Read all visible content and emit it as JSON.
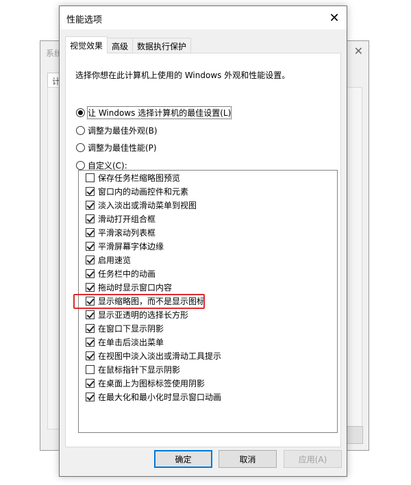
{
  "background_window": {
    "title": "系统",
    "tab_label": "计"
  },
  "dialog": {
    "title": "性能选项",
    "close_glyph": "✕",
    "tabs": [
      {
        "label": "视觉效果",
        "active": true
      },
      {
        "label": "高级",
        "active": false
      },
      {
        "label": "数据执行保护",
        "active": false
      }
    ],
    "description": "选择你想在此计算机上使用的 Windows 外观和性能设置。",
    "radios": [
      {
        "label": "让 Windows 选择计算机的最佳设置(L)",
        "checked": true
      },
      {
        "label": "调整为最佳外观(B)",
        "checked": false
      },
      {
        "label": "调整为最佳性能(P)",
        "checked": false
      },
      {
        "label": "自定义(C):",
        "checked": false
      }
    ],
    "options": [
      {
        "label": "保存任务栏缩略图预览",
        "checked": false
      },
      {
        "label": "窗口内的动画控件和元素",
        "checked": true
      },
      {
        "label": "淡入淡出或滑动菜单到视图",
        "checked": true
      },
      {
        "label": "滑动打开组合框",
        "checked": true
      },
      {
        "label": "平滑滚动列表框",
        "checked": true
      },
      {
        "label": "平滑屏幕字体边缘",
        "checked": true
      },
      {
        "label": "启用速览",
        "checked": true
      },
      {
        "label": "任务栏中的动画",
        "checked": true
      },
      {
        "label": "拖动时显示窗口内容",
        "checked": true
      },
      {
        "label": "显示缩略图，而不是显示图标",
        "checked": true
      },
      {
        "label": "显示亚透明的选择长方形",
        "checked": true
      },
      {
        "label": "在窗口下显示阴影",
        "checked": true
      },
      {
        "label": "在单击后淡出菜单",
        "checked": true
      },
      {
        "label": "在视图中淡入淡出或滑动工具提示",
        "checked": true
      },
      {
        "label": "在鼠标指针下显示阴影",
        "checked": false
      },
      {
        "label": "在桌面上为图标标签使用阴影",
        "checked": true
      },
      {
        "label": "在最大化和最小化时显示窗口动画",
        "checked": true
      }
    ],
    "buttons": {
      "ok": "确定",
      "cancel": "取消",
      "apply": "应用(A)"
    }
  },
  "colors": {
    "highlight_border": "#e0292c",
    "primary_button_border": "#0078d7"
  }
}
